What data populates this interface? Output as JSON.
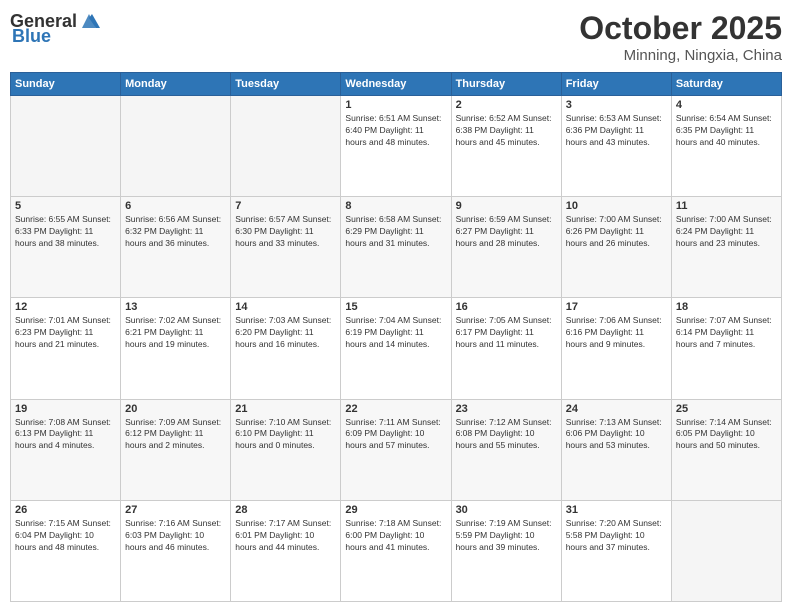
{
  "header": {
    "logo_general": "General",
    "logo_blue": "Blue",
    "month": "October 2025",
    "location": "Minning, Ningxia, China"
  },
  "weekdays": [
    "Sunday",
    "Monday",
    "Tuesday",
    "Wednesday",
    "Thursday",
    "Friday",
    "Saturday"
  ],
  "weeks": [
    [
      {
        "day": "",
        "info": ""
      },
      {
        "day": "",
        "info": ""
      },
      {
        "day": "",
        "info": ""
      },
      {
        "day": "1",
        "info": "Sunrise: 6:51 AM\nSunset: 6:40 PM\nDaylight: 11 hours\nand 48 minutes."
      },
      {
        "day": "2",
        "info": "Sunrise: 6:52 AM\nSunset: 6:38 PM\nDaylight: 11 hours\nand 45 minutes."
      },
      {
        "day": "3",
        "info": "Sunrise: 6:53 AM\nSunset: 6:36 PM\nDaylight: 11 hours\nand 43 minutes."
      },
      {
        "day": "4",
        "info": "Sunrise: 6:54 AM\nSunset: 6:35 PM\nDaylight: 11 hours\nand 40 minutes."
      }
    ],
    [
      {
        "day": "5",
        "info": "Sunrise: 6:55 AM\nSunset: 6:33 PM\nDaylight: 11 hours\nand 38 minutes."
      },
      {
        "day": "6",
        "info": "Sunrise: 6:56 AM\nSunset: 6:32 PM\nDaylight: 11 hours\nand 36 minutes."
      },
      {
        "day": "7",
        "info": "Sunrise: 6:57 AM\nSunset: 6:30 PM\nDaylight: 11 hours\nand 33 minutes."
      },
      {
        "day": "8",
        "info": "Sunrise: 6:58 AM\nSunset: 6:29 PM\nDaylight: 11 hours\nand 31 minutes."
      },
      {
        "day": "9",
        "info": "Sunrise: 6:59 AM\nSunset: 6:27 PM\nDaylight: 11 hours\nand 28 minutes."
      },
      {
        "day": "10",
        "info": "Sunrise: 7:00 AM\nSunset: 6:26 PM\nDaylight: 11 hours\nand 26 minutes."
      },
      {
        "day": "11",
        "info": "Sunrise: 7:00 AM\nSunset: 6:24 PM\nDaylight: 11 hours\nand 23 minutes."
      }
    ],
    [
      {
        "day": "12",
        "info": "Sunrise: 7:01 AM\nSunset: 6:23 PM\nDaylight: 11 hours\nand 21 minutes."
      },
      {
        "day": "13",
        "info": "Sunrise: 7:02 AM\nSunset: 6:21 PM\nDaylight: 11 hours\nand 19 minutes."
      },
      {
        "day": "14",
        "info": "Sunrise: 7:03 AM\nSunset: 6:20 PM\nDaylight: 11 hours\nand 16 minutes."
      },
      {
        "day": "15",
        "info": "Sunrise: 7:04 AM\nSunset: 6:19 PM\nDaylight: 11 hours\nand 14 minutes."
      },
      {
        "day": "16",
        "info": "Sunrise: 7:05 AM\nSunset: 6:17 PM\nDaylight: 11 hours\nand 11 minutes."
      },
      {
        "day": "17",
        "info": "Sunrise: 7:06 AM\nSunset: 6:16 PM\nDaylight: 11 hours\nand 9 minutes."
      },
      {
        "day": "18",
        "info": "Sunrise: 7:07 AM\nSunset: 6:14 PM\nDaylight: 11 hours\nand 7 minutes."
      }
    ],
    [
      {
        "day": "19",
        "info": "Sunrise: 7:08 AM\nSunset: 6:13 PM\nDaylight: 11 hours\nand 4 minutes."
      },
      {
        "day": "20",
        "info": "Sunrise: 7:09 AM\nSunset: 6:12 PM\nDaylight: 11 hours\nand 2 minutes."
      },
      {
        "day": "21",
        "info": "Sunrise: 7:10 AM\nSunset: 6:10 PM\nDaylight: 11 hours\nand 0 minutes."
      },
      {
        "day": "22",
        "info": "Sunrise: 7:11 AM\nSunset: 6:09 PM\nDaylight: 10 hours\nand 57 minutes."
      },
      {
        "day": "23",
        "info": "Sunrise: 7:12 AM\nSunset: 6:08 PM\nDaylight: 10 hours\nand 55 minutes."
      },
      {
        "day": "24",
        "info": "Sunrise: 7:13 AM\nSunset: 6:06 PM\nDaylight: 10 hours\nand 53 minutes."
      },
      {
        "day": "25",
        "info": "Sunrise: 7:14 AM\nSunset: 6:05 PM\nDaylight: 10 hours\nand 50 minutes."
      }
    ],
    [
      {
        "day": "26",
        "info": "Sunrise: 7:15 AM\nSunset: 6:04 PM\nDaylight: 10 hours\nand 48 minutes."
      },
      {
        "day": "27",
        "info": "Sunrise: 7:16 AM\nSunset: 6:03 PM\nDaylight: 10 hours\nand 46 minutes."
      },
      {
        "day": "28",
        "info": "Sunrise: 7:17 AM\nSunset: 6:01 PM\nDaylight: 10 hours\nand 44 minutes."
      },
      {
        "day": "29",
        "info": "Sunrise: 7:18 AM\nSunset: 6:00 PM\nDaylight: 10 hours\nand 41 minutes."
      },
      {
        "day": "30",
        "info": "Sunrise: 7:19 AM\nSunset: 5:59 PM\nDaylight: 10 hours\nand 39 minutes."
      },
      {
        "day": "31",
        "info": "Sunrise: 7:20 AM\nSunset: 5:58 PM\nDaylight: 10 hours\nand 37 minutes."
      },
      {
        "day": "",
        "info": ""
      }
    ]
  ]
}
